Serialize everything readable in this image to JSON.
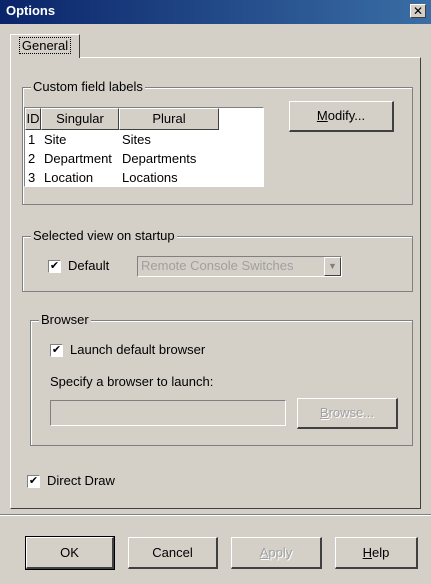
{
  "window": {
    "title": "Options",
    "close_glyph": "✕"
  },
  "tabs": [
    {
      "label": "General",
      "selected": true
    }
  ],
  "custom_fields": {
    "title": "Custom field labels",
    "headers": {
      "id": "ID",
      "singular": "Singular",
      "plural": "Plural"
    },
    "rows": [
      {
        "id": "1",
        "singular": "Site",
        "plural": "Sites"
      },
      {
        "id": "2",
        "singular": "Department",
        "plural": "Departments"
      },
      {
        "id": "3",
        "singular": "Location",
        "plural": "Locations"
      }
    ],
    "modify_button": {
      "mnemonic": "M",
      "rest": "odify..."
    }
  },
  "startup_view": {
    "title": "Selected view on startup",
    "default_checkbox": {
      "label": "Default",
      "checked": true
    },
    "view_select": {
      "value": "Remote Console Switches",
      "enabled": false
    }
  },
  "browser": {
    "title": "Browser",
    "launch_default": {
      "label": "Launch default browser",
      "checked": true
    },
    "specify_label": "Specify a browser to launch:",
    "path_value": "",
    "browse_button": {
      "mnemonic": "B",
      "rest": "rowse...",
      "enabled": false
    }
  },
  "direct_draw": {
    "label": "Direct Draw",
    "checked": true
  },
  "footer_buttons": {
    "ok": "OK",
    "cancel": "Cancel",
    "apply": {
      "mnemonic": "A",
      "rest": "pply",
      "enabled": false
    },
    "help": {
      "mnemonic": "H",
      "rest": "elp"
    }
  },
  "check_glyph": "✔",
  "dropdown_glyph": "▼",
  "colors": {
    "title_bar_start": "#0a246a",
    "title_bar_end": "#3a6ea5",
    "face": "#d4d0c8"
  }
}
